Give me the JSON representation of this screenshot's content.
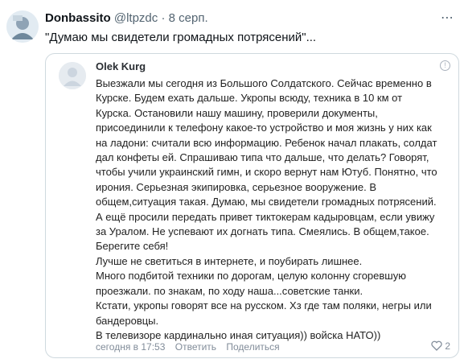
{
  "tweet": {
    "author_name": "Donbassito",
    "handle": "@ltpzdc",
    "separator": "·",
    "date": "8 серп.",
    "text": "\"Думаю мы свидетели громадных потрясений\"..."
  },
  "embed": {
    "author_name": "Olek Kurg",
    "comment_lines": [
      "Выезжали мы сегодня из Большого Солдатского. Сейчас временно в",
      "Курске. Будем ехать дальше. Укропы всюду, техника в 10 км от",
      "Курска. Остановили нашу машину, проверили документы,",
      "присоединили к телефону какое-то устройство и моя жизнь у них как",
      "на ладони: считали всю информацию. Ребенок начал плакать, солдат",
      "дал конфеты ей. Спрашиваю типа что дальше, что делать? Говорят,",
      "чтобы учили украинский гимн, и скоро вернут нам Ютуб. Понятно, что",
      "ирония. Серьезная экипировка, серьезное вооружение. В",
      "общем,ситуация такая. Думаю, мы свидетели громадных потрясений.",
      "А ещё просили передать привет тиктокерам кадыровцам, если увижу",
      "за Уралом. Не успевают их догнать типа. Смеялись. В общем,такое.",
      "Берегите себя!",
      "Лучше не светиться в интернете, и поубирать лишнее.",
      "Много подбитой техники по дорогам, целую колонну сгоревшую",
      "проезжали. по знакам, по ходу наша...советские танки.",
      "Кстати, укропы говорят все на русском. Хз где там поляки, негры или",
      "бандеровцы.",
      "В телевизоре кардинально иная ситуация)) войска НАТО))"
    ],
    "timestamp": "сегодня в 17:53",
    "reply_label": "Ответить",
    "share_label": "Поделиться",
    "like_count": "2"
  },
  "icons": {
    "menu": "more-horizontal-icon",
    "info": "info-icon",
    "like": "heart-icon"
  }
}
